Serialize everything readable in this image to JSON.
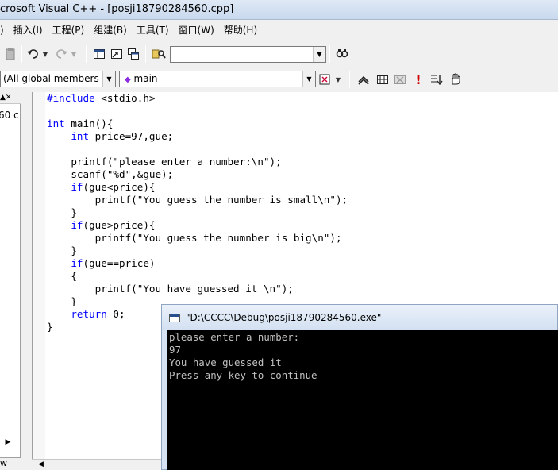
{
  "window": {
    "title": "crosoft Visual C++ - [posji18790284560.cpp]"
  },
  "menu": [
    {
      "label": ")"
    },
    {
      "label": "插入(I)"
    },
    {
      "label": "工程(P)"
    },
    {
      "label": "组建(B)"
    },
    {
      "label": "工具(T)"
    },
    {
      "label": "窗口(W)"
    },
    {
      "label": "帮助(H)"
    }
  ],
  "toolbar": {
    "find_combo_value": "",
    "class_combo_value": "(All global members",
    "member_combo_value": "main"
  },
  "left_pane": {
    "fragment": "60 c",
    "tab_label": "w"
  },
  "editor": {
    "lines": [
      "#include <stdio.h>",
      "",
      "int main(){",
      "    int price=97,gue;",
      "",
      "    printf(\"please enter a number:\\n\");",
      "    scanf(\"%d\",&gue);",
      "    if(gue<price){",
      "        printf(\"You guess the number is small\\n\");",
      "    }",
      "    if(gue>price){",
      "        printf(\"You guess the numnber is big\\n\");",
      "    }",
      "    if(gue==price)",
      "    {",
      "        printf(\"You have guessed it \\n\");",
      "    }",
      "    return 0;",
      "}"
    ]
  },
  "console": {
    "title": "\"D:\\CCCC\\Debug\\posji18790284560.exe\"",
    "output": "please enter a number:\n97\nYou have guessed it\nPress any key to continue"
  },
  "icons": [
    "paste-icon",
    "undo-icon",
    "redo-icon",
    "workspace-icon",
    "output-icon",
    "windows-icon",
    "find-in-files-icon",
    "find-icon",
    "wizard-bar-icon",
    "compile-icon",
    "build-icon",
    "stop-build-icon",
    "execute-icon",
    "breakpoint-icon",
    "go-icon"
  ]
}
